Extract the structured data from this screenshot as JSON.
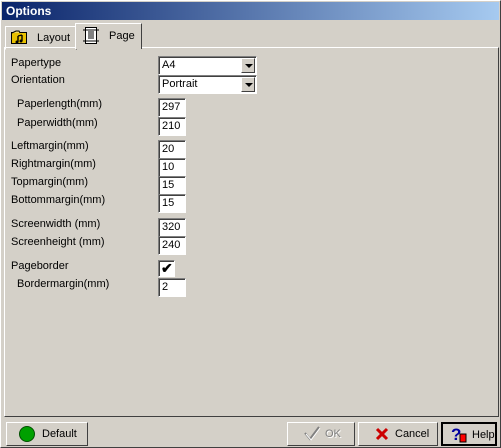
{
  "window": {
    "title": "Options"
  },
  "tabs": [
    {
      "label": "Layout",
      "icon": "folder-music-icon"
    },
    {
      "label": "Page",
      "icon": "page-icon"
    }
  ],
  "form": {
    "papertype": {
      "label": "Papertype",
      "value": "A4"
    },
    "orientation": {
      "label": "Orientation",
      "value": "Portrait"
    },
    "paperlength": {
      "label": "Paperlength(mm)",
      "value": "297"
    },
    "paperwidth": {
      "label": "Paperwidth(mm)",
      "value": "210"
    },
    "leftmargin": {
      "label": "Leftmargin(mm)",
      "value": "20"
    },
    "rightmargin": {
      "label": "Rightmargin(mm)",
      "value": "10"
    },
    "topmargin": {
      "label": "Topmargin(mm)",
      "value": "15"
    },
    "bottommargin": {
      "label": "Bottommargin(mm)",
      "value": "15"
    },
    "screenwidth": {
      "label": "Screenwidth (mm)",
      "value": "320"
    },
    "screenheight": {
      "label": "Screenheight (mm)",
      "value": "240"
    },
    "pageborder": {
      "label": "Pageborder",
      "checked": true
    },
    "bordermargin": {
      "label": "Bordermargin(mm)",
      "value": "2"
    }
  },
  "buttons": {
    "default": {
      "label": "Default",
      "color": "#00a000"
    },
    "ok": {
      "label": "OK",
      "enabled": false
    },
    "cancel": {
      "label": "Cancel",
      "color": "#cc0000"
    },
    "help": {
      "label": "Help"
    }
  }
}
